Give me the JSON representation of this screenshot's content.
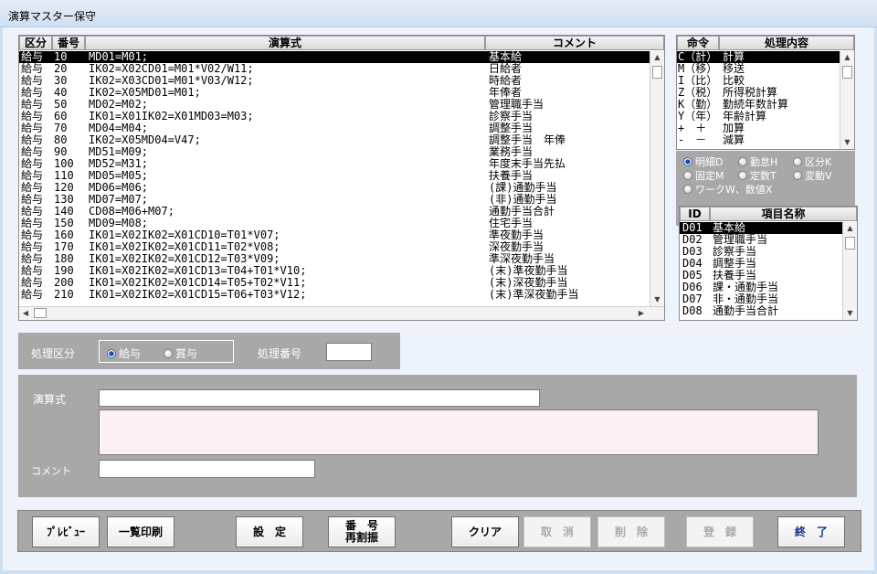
{
  "window": {
    "title": "演算マスター保守"
  },
  "formula_list": {
    "headers": {
      "kubun": "区分",
      "bango": "番号",
      "formula": "演算式",
      "comment": "コメント"
    },
    "rows": [
      {
        "kubun": "給与",
        "bango": "10",
        "formula": "MD01=M01;",
        "comment": "基本給"
      },
      {
        "kubun": "給与",
        "bango": "20",
        "formula": "IK02=X02CD01=M01*V02/W11;",
        "comment": "日給者"
      },
      {
        "kubun": "給与",
        "bango": "30",
        "formula": "IK02=X03CD01=M01*V03/W12;",
        "comment": "時給者"
      },
      {
        "kubun": "給与",
        "bango": "40",
        "formula": "IK02=X05MD01=M01;",
        "comment": "年俸者"
      },
      {
        "kubun": "給与",
        "bango": "50",
        "formula": "MD02=M02;",
        "comment": "管理職手当"
      },
      {
        "kubun": "給与",
        "bango": "60",
        "formula": "IK01=X01IK02=X01MD03=M03;",
        "comment": "診察手当"
      },
      {
        "kubun": "給与",
        "bango": "70",
        "formula": "MD04=M04;",
        "comment": "調整手当"
      },
      {
        "kubun": "給与",
        "bango": "80",
        "formula": "IK02=X05MD04=V47;",
        "comment": "調整手当　年俸"
      },
      {
        "kubun": "給与",
        "bango": "90",
        "formula": "MD51=M09;",
        "comment": "業務手当"
      },
      {
        "kubun": "給与",
        "bango": "100",
        "formula": "MD52=M31;",
        "comment": "年度末手当先払"
      },
      {
        "kubun": "給与",
        "bango": "110",
        "formula": "MD05=M05;",
        "comment": "扶養手当"
      },
      {
        "kubun": "給与",
        "bango": "120",
        "formula": "MD06=M06;",
        "comment": "(課)通勤手当"
      },
      {
        "kubun": "給与",
        "bango": "130",
        "formula": "MD07=M07;",
        "comment": "(非)通勤手当"
      },
      {
        "kubun": "給与",
        "bango": "140",
        "formula": "CD08=M06+M07;",
        "comment": "通勤手当合計"
      },
      {
        "kubun": "給与",
        "bango": "150",
        "formula": "MD09=M08;",
        "comment": "住宅手当"
      },
      {
        "kubun": "給与",
        "bango": "160",
        "formula": "IK01=X02IK02=X01CD10=T01*V07;",
        "comment": "準夜勤手当"
      },
      {
        "kubun": "給与",
        "bango": "170",
        "formula": "IK01=X02IK02=X01CD11=T02*V08;",
        "comment": "深夜勤手当"
      },
      {
        "kubun": "給与",
        "bango": "180",
        "formula": "IK01=X02IK02=X01CD12=T03*V09;",
        "comment": "準深夜勤手当"
      },
      {
        "kubun": "給与",
        "bango": "190",
        "formula": "IK01=X02IK02=X01CD13=T04+T01*V10;",
        "comment": "(末)準夜勤手当"
      },
      {
        "kubun": "給与",
        "bango": "200",
        "formula": "IK01=X02IK02=X01CD14=T05+T02*V11;",
        "comment": "(末)深夜勤手当"
      },
      {
        "kubun": "給与",
        "bango": "210",
        "formula": "IK01=X02IK02=X01CD15=T06+T03*V12;",
        "comment": "(末)準深夜勤手当"
      }
    ]
  },
  "command_list": {
    "headers": {
      "cmd": "命令",
      "desc": "処理内容"
    },
    "rows": [
      {
        "cmd": "C（計）",
        "desc": "計算"
      },
      {
        "cmd": "M（移）",
        "desc": "移送"
      },
      {
        "cmd": "I（比）",
        "desc": "比較"
      },
      {
        "cmd": "Z（税）",
        "desc": "所得税計算"
      },
      {
        "cmd": "K（勤）",
        "desc": "勤続年数計算"
      },
      {
        "cmd": "Y（年）",
        "desc": "年齢計算"
      },
      {
        "cmd": "+　＋",
        "desc": "加算"
      },
      {
        "cmd": "-　－",
        "desc": "減算"
      }
    ]
  },
  "item_category": {
    "options": [
      {
        "label": "明細D",
        "selected": true
      },
      {
        "label": "勤怠H",
        "selected": false
      },
      {
        "label": "区分K",
        "selected": false
      },
      {
        "label": "固定M",
        "selected": false
      },
      {
        "label": "定数T",
        "selected": false
      },
      {
        "label": "変動V",
        "selected": false
      },
      {
        "label": "ワークW、数値X",
        "selected": false
      }
    ]
  },
  "item_list": {
    "headers": {
      "id": "ID",
      "name": "項目名称"
    },
    "rows": [
      {
        "id": "D01",
        "name": "基本給"
      },
      {
        "id": "D02",
        "name": "管理職手当"
      },
      {
        "id": "D03",
        "name": "診察手当"
      },
      {
        "id": "D04",
        "name": "調整手当"
      },
      {
        "id": "D05",
        "name": "扶養手当"
      },
      {
        "id": "D06",
        "name": "課・通勤手当"
      },
      {
        "id": "D07",
        "name": "非・通勤手当"
      },
      {
        "id": "D08",
        "name": "通勤手当合計"
      }
    ]
  },
  "process": {
    "kubun_label": "処理区分",
    "kyuyo_label": "給与",
    "shoyo_label": "賞与",
    "kyuyo_selected": true,
    "bango_label": "処理番号",
    "bango_value": ""
  },
  "editor": {
    "formula_label": "演算式",
    "formula_value": "",
    "comment_label": "コメント",
    "comment_value": ""
  },
  "buttons": {
    "preview": "ﾌﾟﾚﾋﾞｭｰ",
    "list_print": "一覧印刷",
    "settings": "設　定",
    "renumber": "番　号\n再割振",
    "clear": "クリア",
    "cancel": "取　消",
    "delete": "削　除",
    "register": "登　録",
    "exit": "終　了"
  },
  "colors": {
    "selected_row_bg": "#000000",
    "panel_gray": "#a8a8a8",
    "exit_text": "#12318f"
  }
}
